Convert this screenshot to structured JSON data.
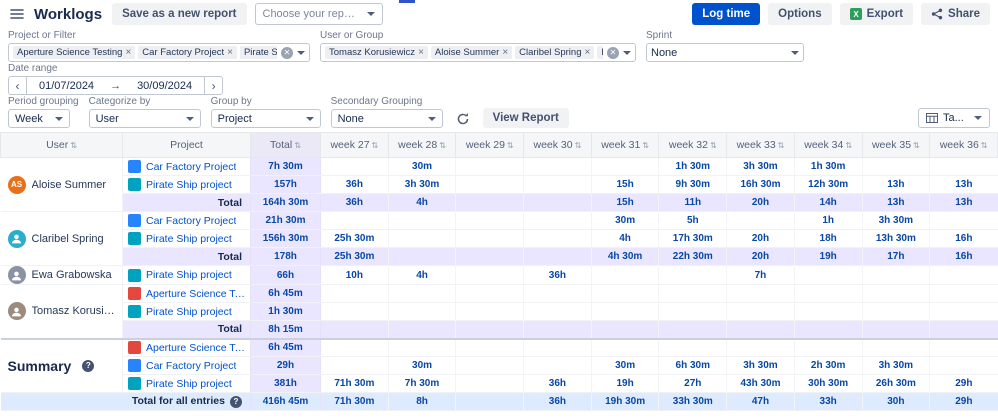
{
  "colors": {
    "primary": "#0052CC",
    "value_text": "#0747A6",
    "lavender": "#EAE6FF",
    "light_blue": "#DEEBFF"
  },
  "topbar": {
    "title": "Worklogs",
    "save_button": "Save as a new report",
    "report_select": "Choose your report...",
    "log_time": "Log time",
    "options": "Options",
    "export": "Export",
    "share": "Share"
  },
  "filters": {
    "project": {
      "label": "Project or Filter",
      "chips": [
        "Aperture Science Testing",
        "Car Factory Project",
        "Pirate Ship project"
      ]
    },
    "user": {
      "label": "User or Group",
      "chips": [
        "Tomasz Korusiewicz",
        "Aloise Summer",
        "Claribel Spring",
        "Ewa Grabowska"
      ]
    },
    "sprint": {
      "label": "Sprint",
      "value": "None"
    },
    "date": {
      "label": "Date range",
      "from": "01/07/2024",
      "to": "30/09/2024",
      "arrow": "→"
    }
  },
  "controls": {
    "period": {
      "label": "Period grouping",
      "value": "Week"
    },
    "categorize": {
      "label": "Categorize by",
      "value": "User"
    },
    "group_by": {
      "label": "Group by",
      "value": "Project"
    },
    "secondary": {
      "label": "Secondary Grouping",
      "value": "None"
    },
    "view_report": "View Report",
    "view_mode": "Ta..."
  },
  "table": {
    "columns": [
      "User",
      "Project",
      "Total",
      "week 27",
      "week 28",
      "week 29",
      "week 30",
      "week 31",
      "week 32",
      "week 33",
      "week 34",
      "week 35",
      "week 36"
    ],
    "groups": [
      {
        "user": "Aloise Summer",
        "avatar": {
          "kind": "initials",
          "label": "AS",
          "bg": "#E8701A"
        },
        "rows": [
          {
            "project": "Car Factory Project",
            "icon": "#2684FF",
            "total": "7h 30m",
            "weeks": [
              "",
              "30m",
              "",
              "",
              "",
              "1h 30m",
              "3h 30m",
              "1h 30m",
              "",
              ""
            ]
          },
          {
            "project": "Pirate Ship project",
            "icon": "#00A3BF",
            "total": "157h",
            "weeks": [
              "36h",
              "3h 30m",
              "",
              "",
              "15h",
              "9h 30m",
              "16h 30m",
              "12h 30m",
              "13h",
              "13h"
            ]
          }
        ],
        "total_row": {
          "label": "Total",
          "total": "164h 30m",
          "weeks": [
            "36h",
            "4h",
            "",
            "",
            "15h",
            "11h",
            "20h",
            "14h",
            "13h",
            "13h"
          ]
        }
      },
      {
        "user": "Claribel Spring",
        "avatar": {
          "kind": "person",
          "bg": "#2BAECB"
        },
        "rows": [
          {
            "project": "Car Factory Project",
            "icon": "#2684FF",
            "total": "21h 30m",
            "weeks": [
              "",
              "",
              "",
              "",
              "30m",
              "5h",
              "",
              "1h",
              "3h 30m",
              ""
            ]
          },
          {
            "project": "Pirate Ship project",
            "icon": "#00A3BF",
            "total": "156h 30m",
            "weeks": [
              "25h 30m",
              "",
              "",
              "",
              "4h",
              "17h 30m",
              "20h",
              "18h",
              "13h 30m",
              "16h"
            ]
          }
        ],
        "total_row": {
          "label": "Total",
          "total": "178h",
          "weeks": [
            "25h 30m",
            "",
            "",
            "",
            "4h 30m",
            "22h 30m",
            "20h",
            "19h",
            "17h",
            "16h"
          ]
        }
      },
      {
        "user": "Ewa Grabowska",
        "avatar": {
          "kind": "person",
          "bg": "#8993A4"
        },
        "rows": [
          {
            "project": "Pirate Ship project",
            "icon": "#00A3BF",
            "total": "66h",
            "weeks": [
              "10h",
              "4h",
              "",
              "36h",
              "",
              "",
              "7h",
              "",
              "",
              ""
            ]
          }
        ],
        "total_row": null
      },
      {
        "user": "Tomasz Korusiewicz",
        "avatar": {
          "kind": "person",
          "bg": "#9C8B7E"
        },
        "rows": [
          {
            "project": "Aperture Science Testing",
            "icon": "#E2483D",
            "total": "6h 45m",
            "weeks": [
              "",
              "",
              "",
              "",
              "",
              "",
              "",
              "",
              "",
              ""
            ]
          },
          {
            "project": "Pirate Ship project",
            "icon": "#00A3BF",
            "total": "1h 30m",
            "weeks": [
              "",
              "",
              "",
              "",
              "",
              "",
              "",
              "",
              "",
              ""
            ]
          }
        ],
        "total_row": {
          "label": "Total",
          "total": "8h 15m",
          "weeks": [
            "",
            "",
            "",
            "",
            "",
            "",
            "",
            "",
            "",
            ""
          ]
        }
      },
      {
        "user": "Summary",
        "summary": true,
        "rows": [
          {
            "project": "Aperture Science Testing",
            "icon": "#E2483D",
            "total": "6h 45m",
            "weeks": [
              "",
              "",
              "",
              "",
              "",
              "",
              "",
              "",
              "",
              ""
            ]
          },
          {
            "project": "Car Factory Project",
            "icon": "#2684FF",
            "total": "29h",
            "weeks": [
              "",
              "30m",
              "",
              "",
              "30m",
              "6h 30m",
              "3h 30m",
              "2h 30m",
              "3h 30m",
              ""
            ]
          },
          {
            "project": "Pirate Ship project",
            "icon": "#00A3BF",
            "total": "381h",
            "weeks": [
              "71h 30m",
              "7h 30m",
              "",
              "36h",
              "19h",
              "27h",
              "43h 30m",
              "30h 30m",
              "26h 30m",
              "29h"
            ]
          }
        ],
        "total_row": null
      }
    ],
    "grand_total": {
      "label": "Total for all entries",
      "total": "416h 45m",
      "weeks": [
        "71h 30m",
        "8h",
        "",
        "36h",
        "19h 30m",
        "33h 30m",
        "47h",
        "33h",
        "30h",
        "29h"
      ]
    }
  }
}
